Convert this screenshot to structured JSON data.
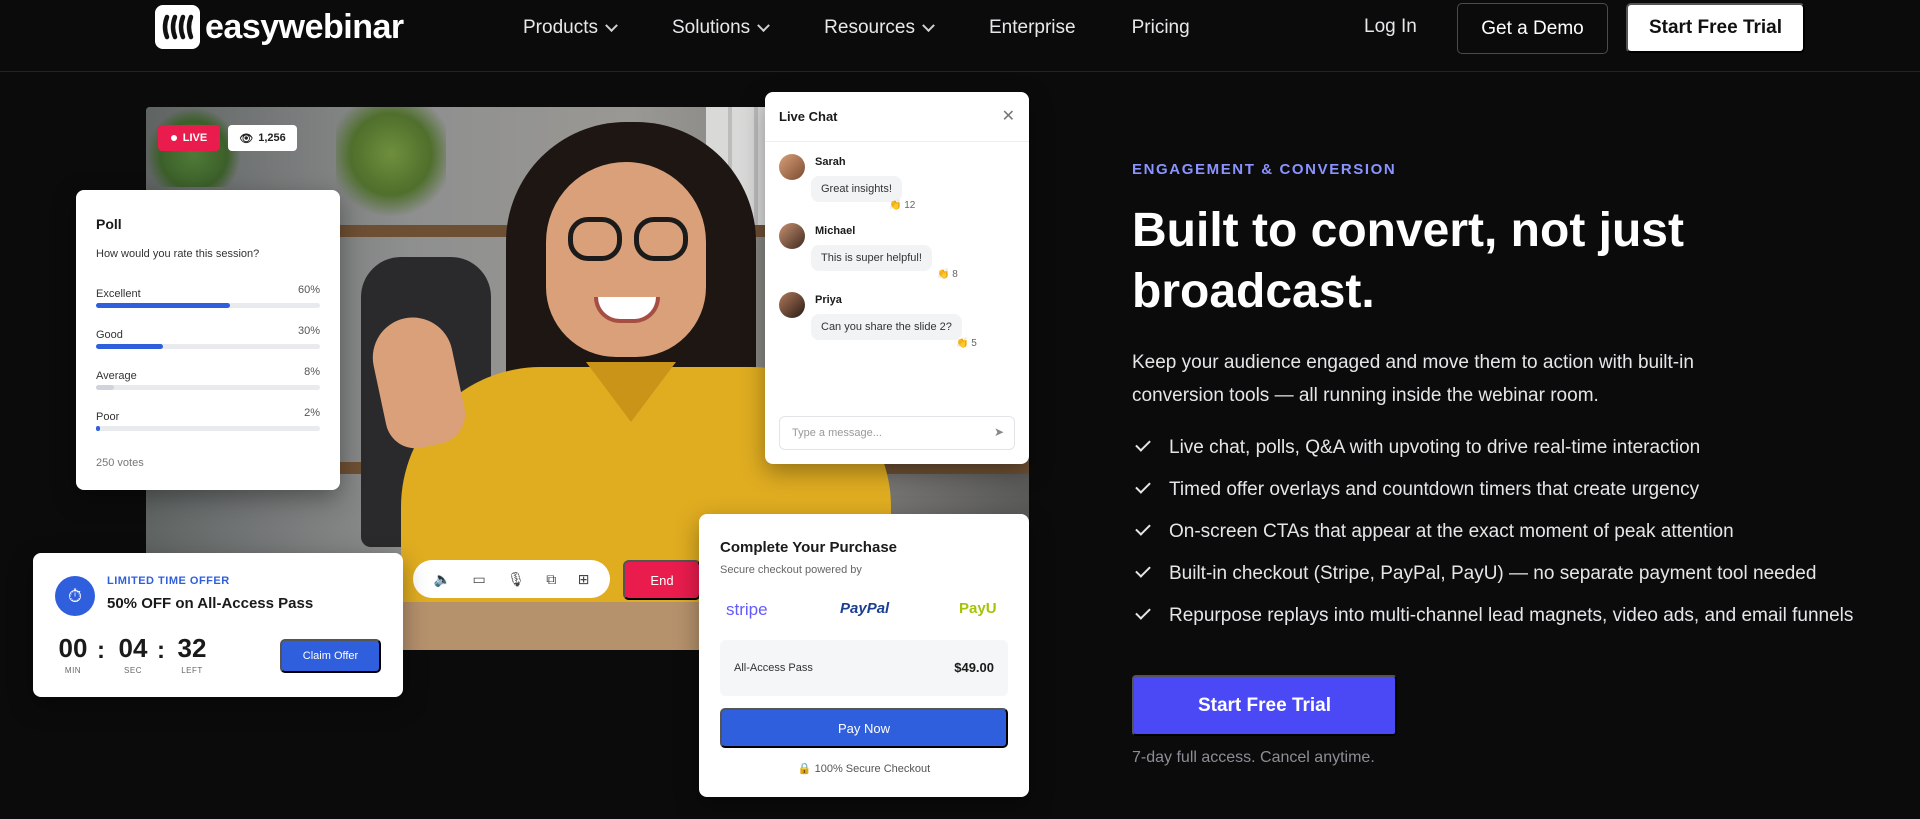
{
  "brand": {
    "name": "easywebinar"
  },
  "nav": {
    "items": [
      {
        "label": "Products",
        "dropdown": true
      },
      {
        "label": "Solutions",
        "dropdown": true
      },
      {
        "label": "Resources",
        "dropdown": true
      },
      {
        "label": "Enterprise",
        "dropdown": false
      },
      {
        "label": "Pricing",
        "dropdown": false
      }
    ],
    "login": "Log In",
    "demo": "Get a Demo",
    "trial": "Start Free Trial"
  },
  "video": {
    "live_label": "LIVE",
    "viewers": "1,256",
    "end_label": "End",
    "controls": [
      "speaker-icon",
      "camera-icon",
      "mic-icon",
      "screen-share-icon",
      "grid-icon"
    ]
  },
  "poll": {
    "title": "Poll",
    "question": "How would you rate this session?",
    "options": [
      {
        "label": "Excellent",
        "pct": "60%",
        "value": 60
      },
      {
        "label": "Good",
        "pct": "30%",
        "value": 30
      },
      {
        "label": "Average",
        "pct": "8%",
        "value": 8
      },
      {
        "label": "Poor",
        "pct": "2%",
        "value": 2
      }
    ],
    "votes": "250 votes"
  },
  "chat": {
    "title": "Live Chat",
    "messages": [
      {
        "name": "Sarah",
        "text": "Great insights!",
        "reaction": "👏 12"
      },
      {
        "name": "Michael",
        "text": "This is super helpful!",
        "reaction": "👏 8"
      },
      {
        "name": "Priya",
        "text": "Can you share the slide 2?",
        "reaction": "👏 5"
      }
    ],
    "placeholder": "Type a message..."
  },
  "offer": {
    "tag": "LIMITED TIME OFFER",
    "title": "50% OFF on All-Access Pass",
    "countdown": [
      {
        "value": "00",
        "unit": "MIN"
      },
      {
        "value": "04",
        "unit": "SEC"
      },
      {
        "value": "32",
        "unit": "LEFT"
      }
    ],
    "button": "Claim Offer"
  },
  "purchase": {
    "title": "Complete Your Purchase",
    "subtitle": "Secure checkout powered by",
    "providers": [
      "stripe",
      "PayPal",
      "PayU"
    ],
    "item_name": "All-Access Pass",
    "item_price": "$49.00",
    "pay_button": "Pay Now",
    "secure_note": "100% Secure Checkout"
  },
  "hero": {
    "eyebrow": "ENGAGEMENT & CONVERSION",
    "headline": "Built to convert, not just broadcast.",
    "lead": "Keep your audience engaged and move them to action with built-in conversion tools — all running inside the webinar room.",
    "features": [
      "Live chat, polls, Q&A with upvoting to drive real-time interaction",
      "Timed offer overlays and countdown timers that create urgency",
      "On-screen CTAs that appear at the exact moment of peak attention",
      "Built-in checkout (Stripe, PayPal, PayU) — no separate payment tool needed",
      "Repurpose replays into multi-channel lead magnets, video ads, and email funnels"
    ],
    "cta": "Start Free Trial",
    "cta_note": "7-day full access. Cancel anytime."
  },
  "colors": {
    "accent": "#4a49f5",
    "link_blue": "#2f5fdc",
    "live_red": "#e91c4d",
    "eyebrow": "#8b93ff",
    "stripe": "#635bff",
    "paypal": "#1b3f92",
    "payu": "#a6c307"
  }
}
